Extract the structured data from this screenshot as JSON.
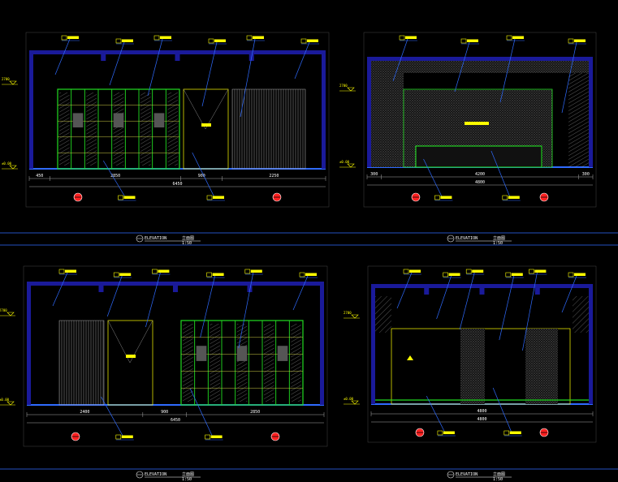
{
  "drawing": {
    "colors": {
      "background": "#000000",
      "frame": "#2f6bff",
      "ceiling": "#1a1a9a",
      "cabinet": "#22dd22",
      "leader": "#2f6bff",
      "tag": "#ffff00",
      "marker": "#ff2020",
      "hatch": "#bbbbbb"
    },
    "panels": [
      {
        "title": "ELEVATION",
        "title_cn": "立面图",
        "scale": "1:50",
        "dims": [
          "450",
          "2850",
          "900",
          "2250"
        ],
        "total": "6450",
        "levels": [
          "2700",
          "±0.00"
        ]
      },
      {
        "title": "ELEVATION",
        "title_cn": "立面图",
        "scale": "1:50",
        "dims": [
          "300",
          "4200",
          "300"
        ],
        "total": "4800",
        "levels": [
          "2700",
          "±0.00"
        ]
      },
      {
        "title": "ELEVATION",
        "title_cn": "立面图",
        "scale": "1:50",
        "dims": [
          "2400",
          "900",
          "2850"
        ],
        "total": "6450",
        "levels": [
          "2700",
          "±0.00"
        ]
      },
      {
        "title": "ELEVATION",
        "title_cn": "立面图",
        "scale": "1:50",
        "dims": [
          "4800"
        ],
        "total": "4800",
        "levels": [
          "2700",
          "±0.00"
        ]
      }
    ]
  }
}
